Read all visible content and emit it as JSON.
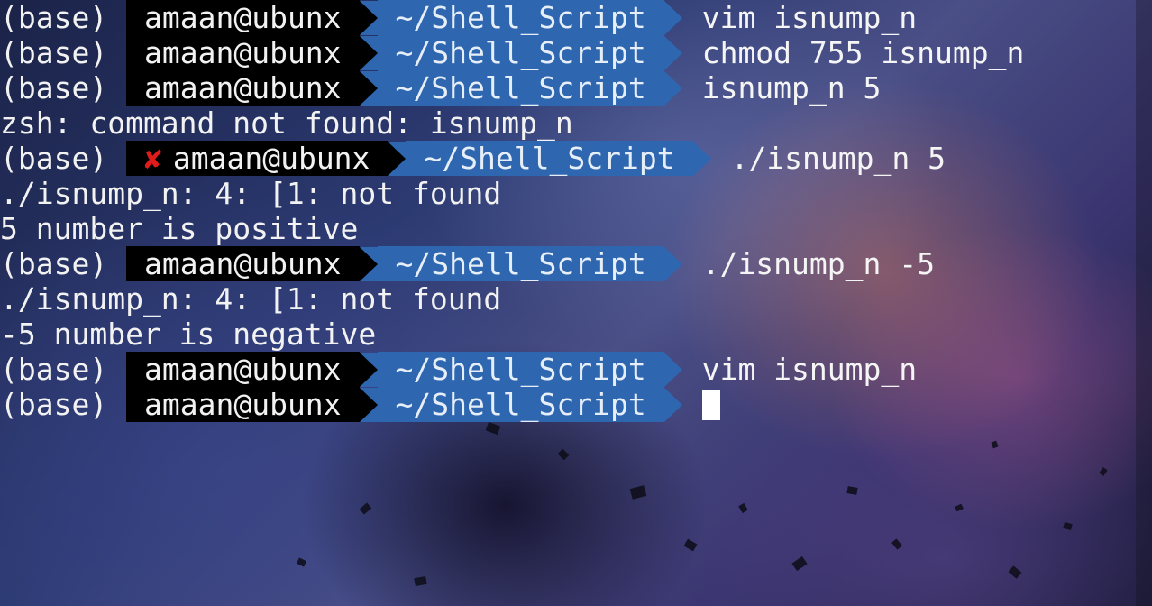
{
  "colors": {
    "user_segment_bg": "#000000",
    "path_segment_bg": "#2e66b0",
    "error_mark": "#e01b1b",
    "text": "#f2f2f2"
  },
  "prompt": {
    "env": "(base)",
    "user_host": "amaan@ubunx",
    "path": "~/Shell_Script",
    "error_icon": "✘"
  },
  "lines": {
    "l1": {
      "cmd": "vim isnump_n"
    },
    "l2": {
      "cmd": "chmod 755 isnump_n"
    },
    "l3": {
      "cmd": "isnump_n 5"
    },
    "l4": {
      "text": "zsh: command not found: isnump_n"
    },
    "l5": {
      "cmd": "./isnump_n 5"
    },
    "l6": {
      "text": "./isnump_n: 4: [1: not found"
    },
    "l7": {
      "text": "5 number is positive"
    },
    "l8": {
      "cmd": "./isnump_n -5"
    },
    "l9": {
      "text": "./isnump_n: 4: [1: not found"
    },
    "l10": {
      "text": "-5 number is negative"
    },
    "l11": {
      "cmd": "vim isnump_n"
    },
    "l12": {
      "cmd": ""
    }
  }
}
